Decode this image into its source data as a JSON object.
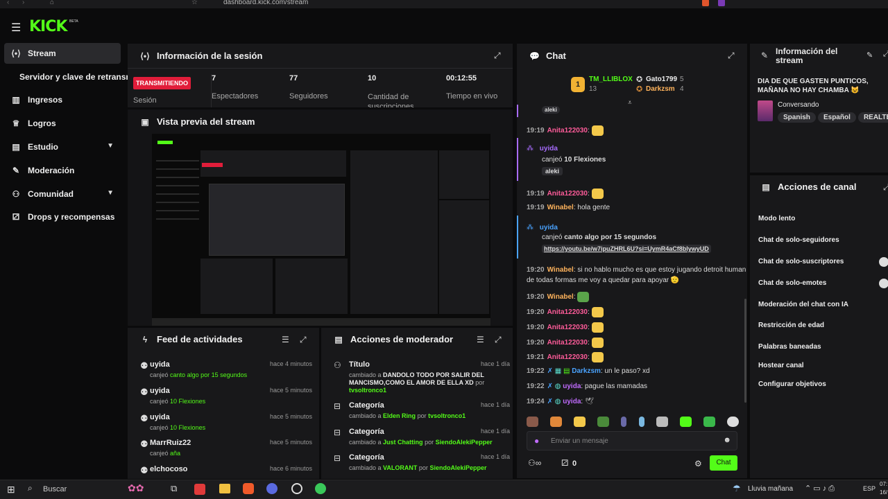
{
  "browser": {
    "url": "dashboard.kick.com/stream"
  },
  "brand": {
    "logo": "KICK",
    "badge": "BETA"
  },
  "sidebar": {
    "items": [
      {
        "label": "Stream",
        "icon": "broadcast-icon"
      },
      {
        "label": "Servidor y clave de retransn",
        "icon": ""
      },
      {
        "label": "Ingresos",
        "icon": "chart-icon"
      },
      {
        "label": "Logros",
        "icon": "trophy-icon"
      },
      {
        "label": "Estudio",
        "icon": "studio-icon"
      },
      {
        "label": "Moderación",
        "icon": "wrench-icon"
      },
      {
        "label": "Comunidad",
        "icon": "people-icon"
      },
      {
        "label": "Drops y recompensas",
        "icon": "gift-icon"
      }
    ]
  },
  "session": {
    "title": "Información de la sesión",
    "status": "TRANSMITIENDO",
    "status_label": "Sesión",
    "stats": [
      {
        "value": "7",
        "label": "Espectadores"
      },
      {
        "value": "77",
        "label": "Seguidores"
      },
      {
        "value": "10",
        "label": "Cantidad de suscripciones"
      },
      {
        "value": "00:12:55",
        "label": "Tiempo en vivo"
      }
    ]
  },
  "preview": {
    "title": "Vista previa del stream"
  },
  "feed": {
    "title": "Feed de actividades",
    "items": [
      {
        "user": "uyida",
        "action": "canjeó",
        "reward": "canto algo por 15 segundos",
        "time": "hace 4 minutos"
      },
      {
        "user": "uyida",
        "action": "canjeó",
        "reward": "10 Flexiones",
        "time": "hace 5 minutos"
      },
      {
        "user": "uyida",
        "action": "canjeó",
        "reward": "10 Flexiones",
        "time": "hace 5 minutos"
      },
      {
        "user": "MarrRuiz22",
        "action": "canjeó",
        "reward": "aña",
        "time": "hace 5 minutos"
      },
      {
        "user": "elchocoso",
        "action": "",
        "reward": "",
        "time": "hace 6 minutos"
      }
    ]
  },
  "mod_actions": {
    "title": "Acciones de moderador",
    "items": [
      {
        "field": "Título",
        "prefix": "cambiado a",
        "value": "DANDOLO TODO POR SALIR DEL MANCISMO,COMO EL AMOR DE ELLA XD",
        "by_label": "por",
        "by": "tvsoltronco1",
        "time": "hace 1 día"
      },
      {
        "field": "Categoría",
        "prefix": "cambiado a",
        "value": "Elden Ring",
        "by_label": "por",
        "by": "tvsoltronco1",
        "time": "hace 1 día"
      },
      {
        "field": "Categoría",
        "prefix": "cambiado a",
        "value": "Just Chatting",
        "by_label": "por",
        "by": "SiendoAlekiPepper",
        "time": "hace 1 día"
      },
      {
        "field": "Categoría",
        "prefix": "cambiado a",
        "value": "VALORANT",
        "by_label": "por",
        "by": "SiendoAlekiPepper",
        "time": "hace 1 día"
      }
    ]
  },
  "chat": {
    "title": "Chat",
    "leaders": [
      {
        "rank": "1",
        "name": "TM_LLIBLOX",
        "count": "13"
      },
      {
        "name": "Gato1799",
        "count": "5"
      },
      {
        "name": "Darkzsm",
        "count": "4"
      }
    ],
    "messages": [
      {
        "text": "aleki"
      },
      {
        "time": "19:19",
        "user": "Anita122030",
        "text": ":"
      },
      {
        "redeem_user": "uyida",
        "redeem_action": "canjeó",
        "redeem_reward": "10 Flexiones",
        "redeem_note": "aleki"
      },
      {
        "time": "19:19",
        "user": "Anita122030",
        "text": ":"
      },
      {
        "time": "19:19",
        "user": "Winabel",
        "text": ": hola gente"
      },
      {
        "redeem_user": "uyida",
        "redeem_action": "canjeó",
        "redeem_reward": "canto algo por 15 segundos",
        "redeem_note": "https://youtu.be/w7ipuZHRL6U?si=UymR4aCf8blywyUD"
      },
      {
        "time": "19:20",
        "user": "Winabel",
        "text": ": si no hablo mucho es que estoy jugando detroit human",
        "text2": "de todas formas me voy a quedar para apoyar 🫡"
      },
      {
        "time": "19:20",
        "user": "Winabel",
        "text": ":"
      },
      {
        "time": "19:20",
        "user": "Anita122030",
        "text": ":"
      },
      {
        "time": "19:20",
        "user": "Anita122030",
        "text": ":"
      },
      {
        "time": "19:20",
        "user": "Anita122030",
        "text": ":"
      },
      {
        "time": "19:21",
        "user": "Anita122030",
        "text": ":"
      },
      {
        "time": "19:22",
        "user": "Darkzsm",
        "text": ": un le paso? xd"
      },
      {
        "time": "19:22",
        "user": "uyida",
        "text": ": pague las mamadas"
      },
      {
        "time": "19:24",
        "user": "uyida",
        "text": ":"
      }
    ],
    "input_placeholder": "Enviar un mensaje",
    "footer_count": "0",
    "send_label": "Chat"
  },
  "stream_info": {
    "title": "Información del stream",
    "stream_title": "DIA DE QUE GASTEN PUNTICOS, MAÑANA NO HAY CHAMBA 😺",
    "category": "Conversando",
    "tags": [
      "Spanish",
      "Español",
      "REALTEAM"
    ]
  },
  "channel_actions": {
    "title": "Acciones de canal",
    "items": [
      "Modo lento",
      "Chat de solo-seguidores",
      "Chat de solo-suscriptores",
      "Chat de solo-emotes",
      "Moderación del chat con IA",
      "Restricción de edad",
      "Palabras baneadas",
      "Hostear canal",
      "Configurar objetivos"
    ]
  },
  "taskbar": {
    "search": "Buscar",
    "weather": "Lluvia mañana",
    "lang": "ESP",
    "time": "07:",
    "date": "16/"
  },
  "colors": {
    "accent": "#53fc18",
    "live": "#e11d3a",
    "bg": "#0b0b0c",
    "panel": "#18181a"
  }
}
